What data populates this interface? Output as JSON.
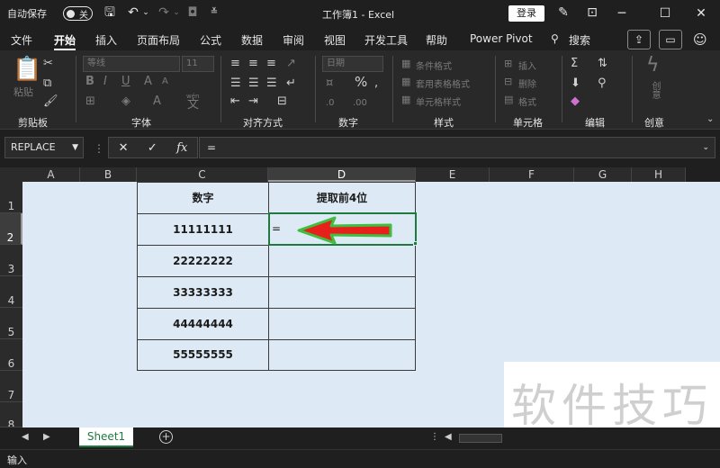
{
  "titlebar": {
    "autosave_label": "自动保存",
    "autosave_state": "关",
    "title": "工作簿1  -  Excel",
    "login_label": "登录",
    "icons": [
      "save-icon",
      "undo-icon",
      "redo-icon",
      "camera-icon",
      "customize-icon",
      "pen-icon",
      "restore-ribbon-icon",
      "minimize-icon",
      "maximize-icon",
      "close-icon"
    ]
  },
  "ribbon_tabs": [
    "文件",
    "开始",
    "插入",
    "页面布局",
    "公式",
    "数据",
    "审阅",
    "视图",
    "开发工具",
    "帮助",
    "Power Pivot",
    "搜索"
  ],
  "active_tab": "开始",
  "ribbon": {
    "clipboard": {
      "paste_label": "粘贴",
      "group_label": "剪贴板"
    },
    "font": {
      "font_name": "等线",
      "font_size": "11",
      "group_label": "字体",
      "wen_label": "wén",
      "wen_char": "文"
    },
    "alignment": {
      "group_label": "对齐方式"
    },
    "number": {
      "format": "日期",
      "group_label": "数字",
      "percent": "%"
    },
    "styles": {
      "cond_format": "条件格式",
      "table_format": "套用表格格式",
      "cell_style": "单元格样式",
      "group_label": "样式"
    },
    "cells": {
      "insert": "插入",
      "delete": "删除",
      "format": "格式",
      "group_label": "单元格"
    },
    "editing": {
      "group_label": "编辑"
    },
    "ideas": {
      "label": "创意",
      "group_label": "创意"
    }
  },
  "formula_bar": {
    "name_box": "REPLACE",
    "cancel": "✕",
    "enter": "✓",
    "fx": "fx",
    "value": "="
  },
  "columns": [
    "A",
    "B",
    "C",
    "D",
    "E",
    "F",
    "G",
    "H"
  ],
  "rows": [
    "1",
    "2",
    "3",
    "4",
    "5",
    "6",
    "7",
    "8"
  ],
  "table": {
    "headers": [
      "数字",
      "提取前4位"
    ],
    "values": [
      "11111111",
      "22222222",
      "33333333",
      "44444444",
      "55555555"
    ],
    "active_cell_value": "="
  },
  "annotation": {
    "arrow_color": "#e8201c",
    "outline_color": "#3fbf3f"
  },
  "sheet_tabs": {
    "active": "Sheet1",
    "add": "+"
  },
  "status": {
    "mode": "输入"
  },
  "watermark": "软件技巧",
  "colors": {
    "accent": "#1f7a3d",
    "sheet_bg": "#ddeaf5",
    "dark_bg": "#1f1f1f"
  }
}
